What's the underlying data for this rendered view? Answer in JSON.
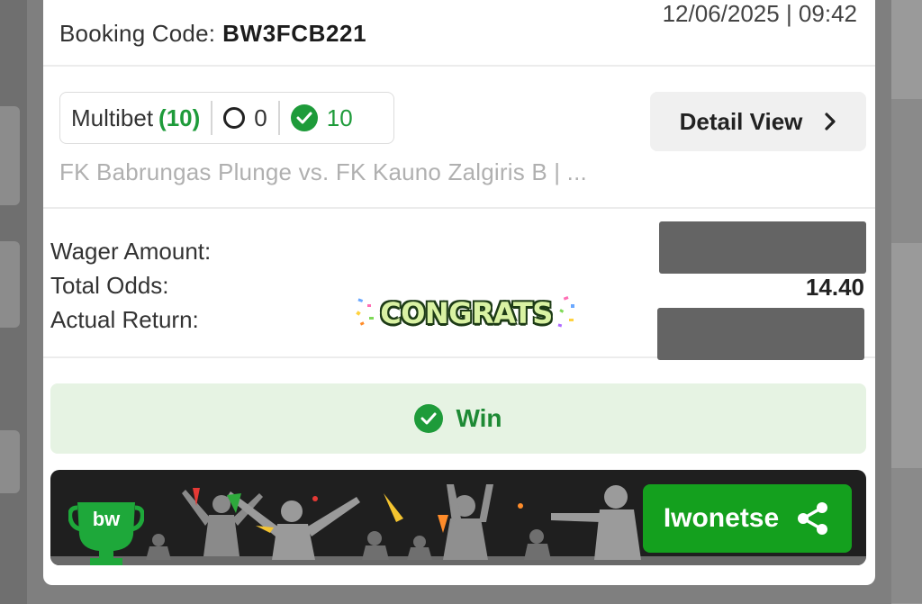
{
  "header": {
    "booking_label": "Booking Code:",
    "booking_code": "BW3FCB221",
    "datetime": "12/06/2025 | 09:42"
  },
  "selection": {
    "bet_type": "Multibet",
    "bet_count": "(10)",
    "lost_count": "0",
    "won_count": "10",
    "detail_label": "Detail View",
    "match_summary": "FK Babrungas Plunge vs. FK Kauno Zalgiris B | ..."
  },
  "summary": {
    "wager_label": "Wager Amount:",
    "odds_label": "Total Odds:",
    "odds_value": "14.40",
    "return_label": "Actual Return:"
  },
  "sticker": {
    "text": "CONGRATS"
  },
  "status": {
    "label": "Win"
  },
  "banner": {
    "logo_text": "bw",
    "share_label": "Iwonetse"
  },
  "colors": {
    "brand_green": "#14a01e",
    "win_bg": "#e6f3e3",
    "win_text": "#1e8a35",
    "redaction": "#646464"
  },
  "icons": [
    "circle-outline-icon",
    "check-circle-icon",
    "chevron-right-icon",
    "share-icon",
    "trophy-logo-icon",
    "confetti-icon"
  ]
}
